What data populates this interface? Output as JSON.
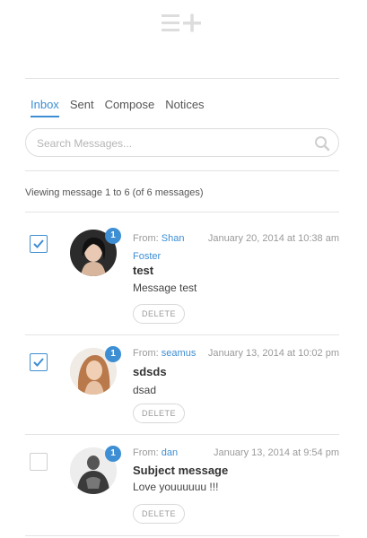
{
  "header": {
    "logo_icon": "compose-plus-logo-icon"
  },
  "tabs": [
    {
      "label": "Inbox",
      "active": true
    },
    {
      "label": "Sent",
      "active": false
    },
    {
      "label": "Compose",
      "active": false
    },
    {
      "label": "Notices",
      "active": false
    }
  ],
  "search": {
    "placeholder": "Search Messages...",
    "value": "",
    "icon": "search-icon"
  },
  "viewing_text": "Viewing message 1 to 6 (of 6 messages)",
  "messages": [
    {
      "checked": true,
      "unread_count": "1",
      "from_label": "From:",
      "from_name_line1": "Shan",
      "from_name_line2": "Foster",
      "date": "January 20, 2014 at 10:38 am",
      "subject": "test",
      "excerpt": "Message test",
      "delete_label": "DELETE"
    },
    {
      "checked": true,
      "unread_count": "1",
      "from_label": "From:",
      "from_name": "seamus",
      "date": "January 13, 2014 at 10:02 pm",
      "subject": "sdsds",
      "excerpt": "dsad",
      "delete_label": "DELETE"
    },
    {
      "checked": false,
      "unread_count": "1",
      "from_label": "From:",
      "from_name": "dan",
      "date": "January 13, 2014 at 9:54 pm",
      "subject": "Subject message",
      "excerpt": "Love youuuuuu !!!",
      "delete_label": "DELETE"
    }
  ],
  "colors": {
    "accent": "#3d8ed3",
    "divider": "#e3e3e3",
    "muted": "#9a9a9a"
  }
}
